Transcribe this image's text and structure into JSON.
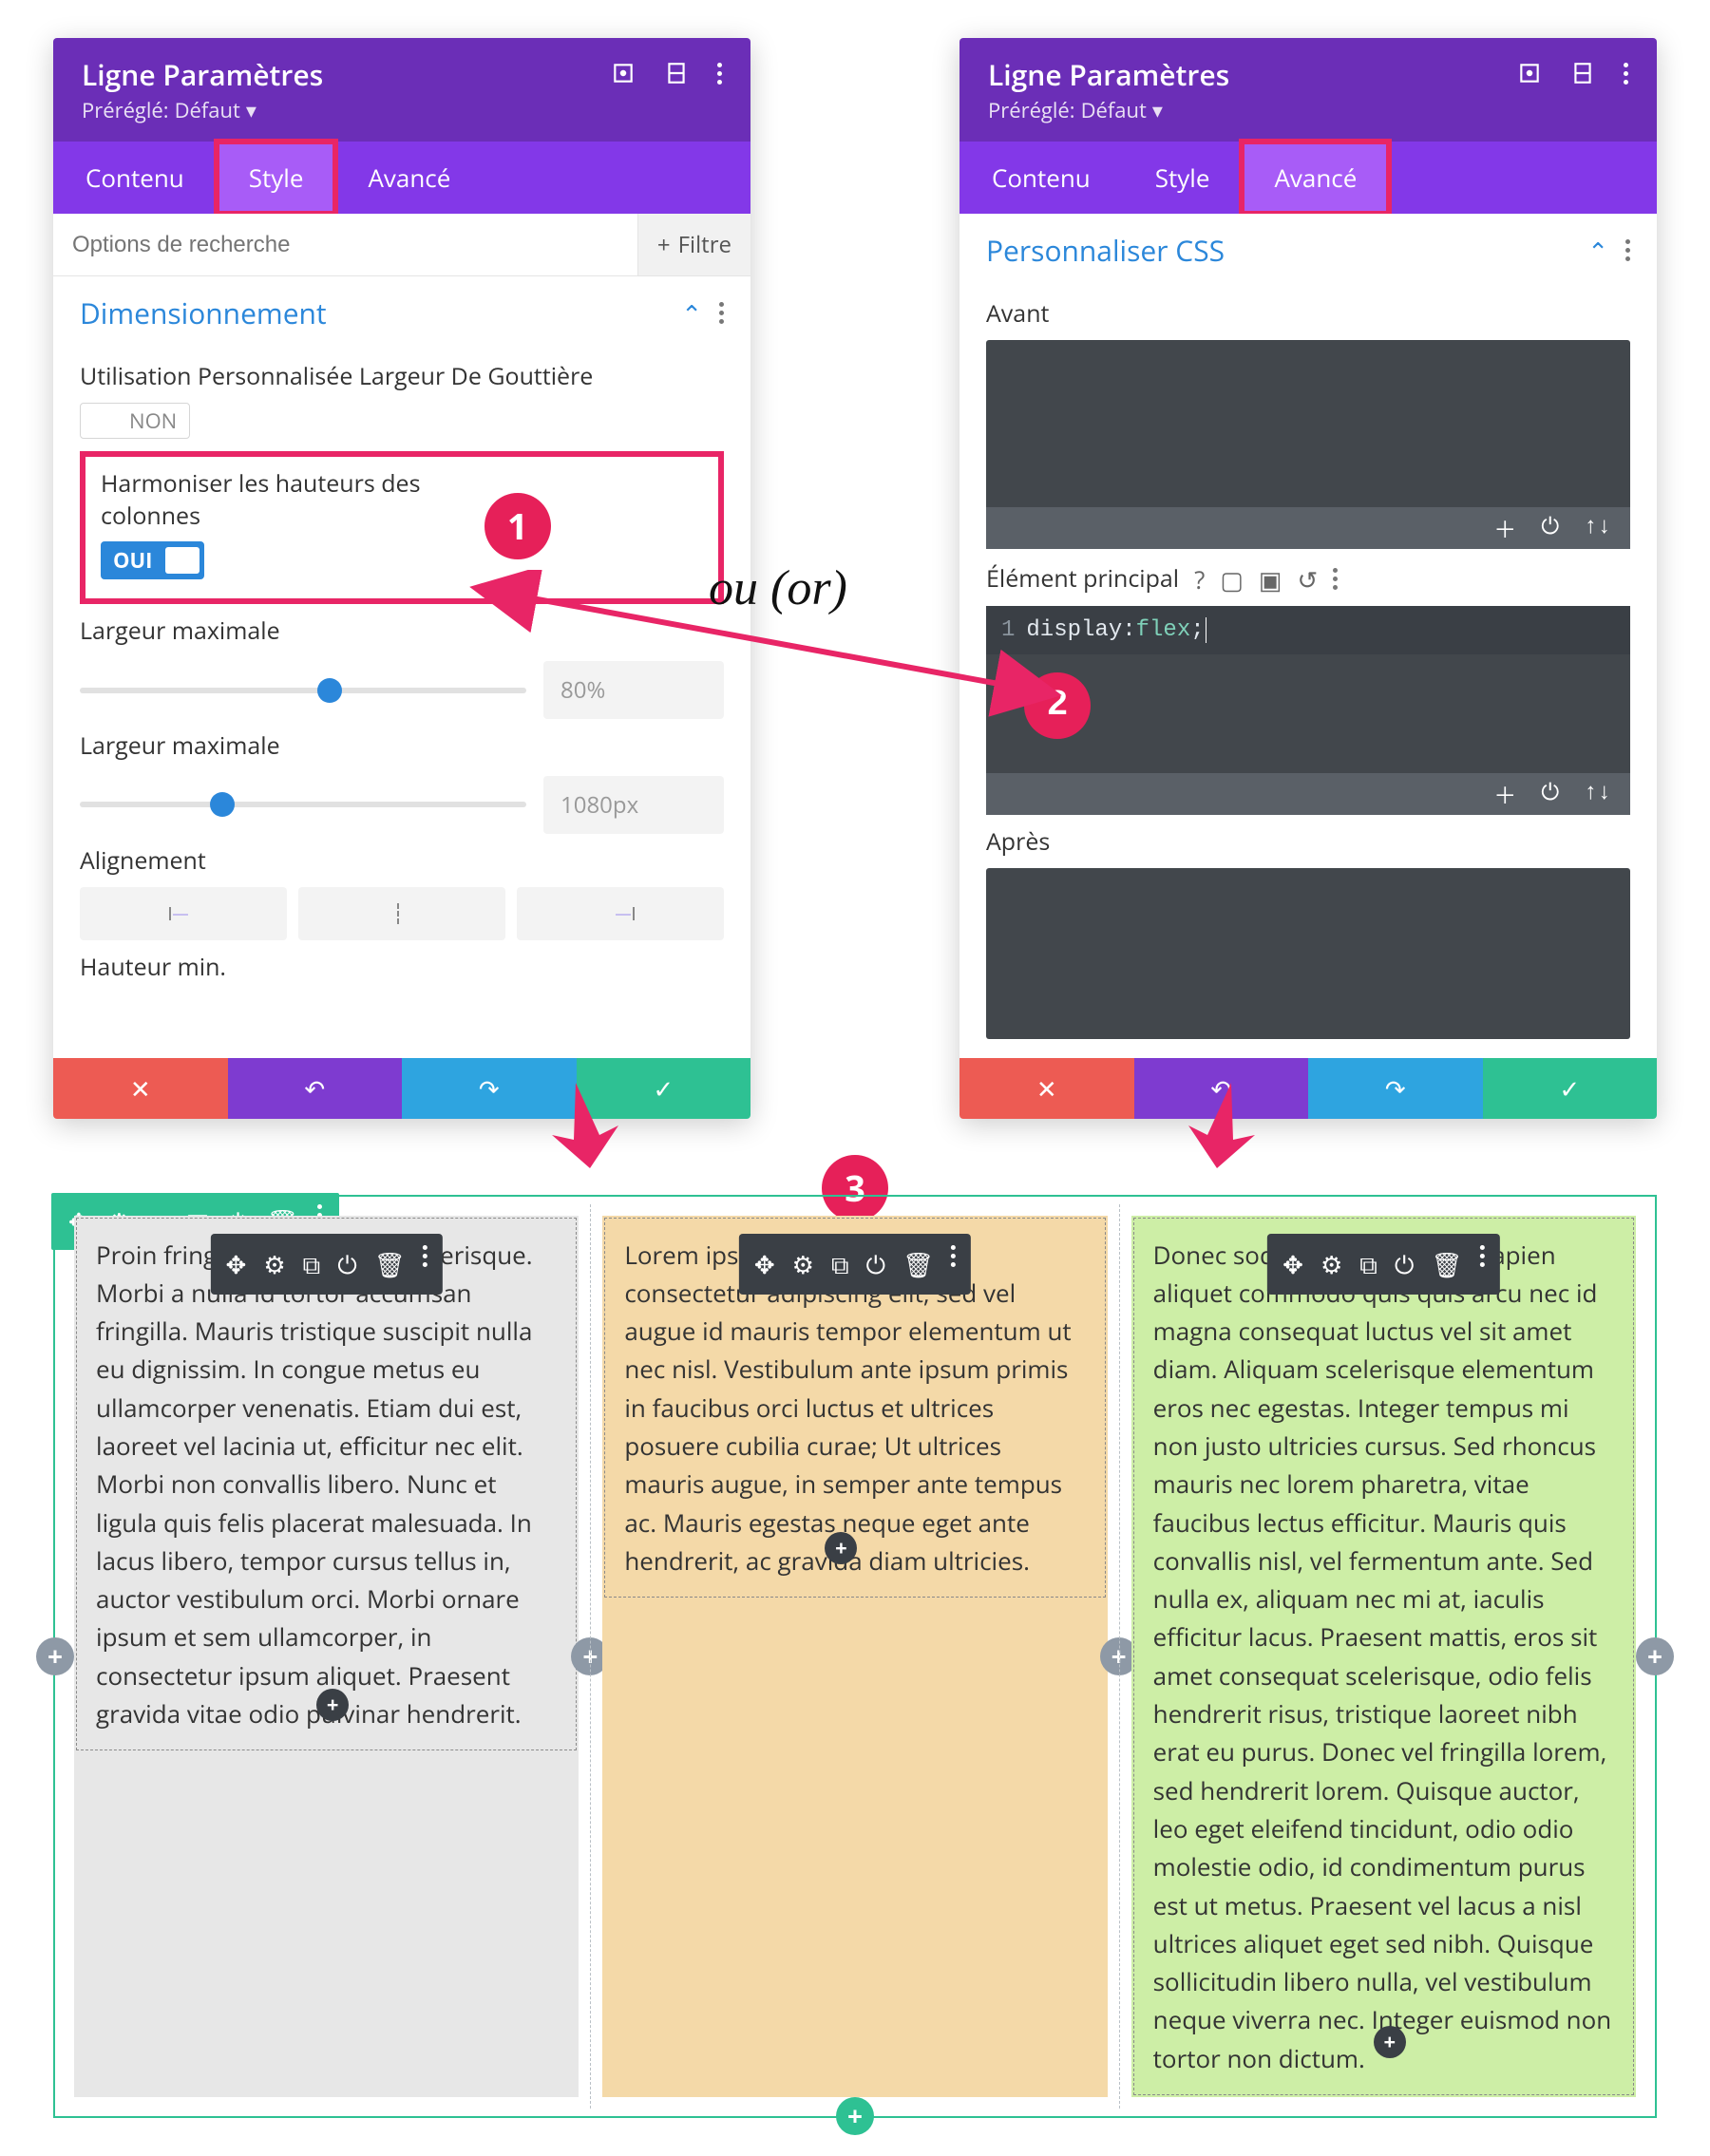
{
  "left": {
    "title": "Ligne Paramètres",
    "preset_label": "Préréglé:",
    "preset_value": "Défaut",
    "tabs": {
      "content": "Contenu",
      "style": "Style",
      "advanced": "Avancé",
      "active": "style"
    },
    "search_placeholder": "Options de recherche",
    "filter_label": "Filtre",
    "section_title": "Dimensionnement",
    "gutter_label": "Utilisation Personnalisée Largeur De Gouttière",
    "gutter_value": "NON",
    "equalize_label": "Harmoniser les hauteurs des colonnes",
    "equalize_value": "OUI",
    "max_width_1_label": "Largeur maximale",
    "max_width_1_value": "80%",
    "max_width_2_label": "Largeur maximale",
    "max_width_2_value": "1080px",
    "alignment_label": "Alignement",
    "min_height_label": "Hauteur min."
  },
  "right": {
    "title": "Ligne Paramètres",
    "preset_label": "Préréglé:",
    "preset_value": "Défaut",
    "tabs": {
      "content": "Contenu",
      "style": "Style",
      "advanced": "Avancé",
      "active": "advanced"
    },
    "section_title": "Personnaliser CSS",
    "before_label": "Avant",
    "main_label": "Élément principal",
    "code_line_number": "1",
    "code_raw": "display:flex;",
    "code_prop": "display:",
    "code_val": "flex",
    "code_end": ";",
    "after_label": "Après"
  },
  "anno": {
    "or_text": "ou (or)",
    "callout_1": "1",
    "callout_2": "2",
    "callout_3": "3"
  },
  "preview": {
    "col_a_text": "Proin fringilla ac risus nec scelerisque. Morbi a nulla id tortor accumsan fringilla. Mauris tristique suscipit nulla eu dignissim. In congue metus eu ullamcorper venenatis. Etiam dui est, laoreet vel lacinia ut, efficitur nec elit. Morbi non convallis libero. Nunc et ligula quis felis placerat malesuada. In lacus libero, tempor cursus tellus in, auctor vestibulum orci. Morbi ornare ipsum et sem ullamcorper, in consectetur ipsum aliquet. Praesent gravida vitae odio pulvinar hendrerit.",
    "col_b_text": "Lorem ipsum dolor sit amet, consectetur adipiscing elit, sed vel augue id mauris tempor elementum ut nec nisl. Vestibulum ante ipsum primis in faucibus orci luctus et ultrices posuere cubilia curae; Ut ultrices mauris augue, in semper ante tempus ac. Mauris egestas neque eget ante hendrerit, ac gravida diam ultricies.",
    "col_c_text": "Donec sodales orci faucibus sapien aliquet commodo quis quis arcu nec id magna consequat luctus vel sit amet diam. Aliquam scelerisque elementum eros nec egestas. Integer tempus mi non justo ultricies cursus. Sed rhoncus mauris nec lorem pharetra, vitae faucibus lectus efficitur. Mauris quis convallis nisl, vel fermentum ante. Sed nulla ex, aliquam nec mi at, iaculis efficitur lacus. Praesent mattis, eros sit amet consequat scelerisque, odio felis hendrerit risus, tristique laoreet nibh erat eu purus. Donec vel fringilla lorem, sed hendrerit lorem. Quisque auctor, leo eget eleifend tincidunt, odio odio molestie odio, id condimentum purus est ut metus. Praesent vel lacus a nisl ultrices aliquet eget sed nibh. Quisque sollicitudin libero nulla, vel vestibulum neque viverra nec. Integer euismod non tortor non dictum."
  }
}
